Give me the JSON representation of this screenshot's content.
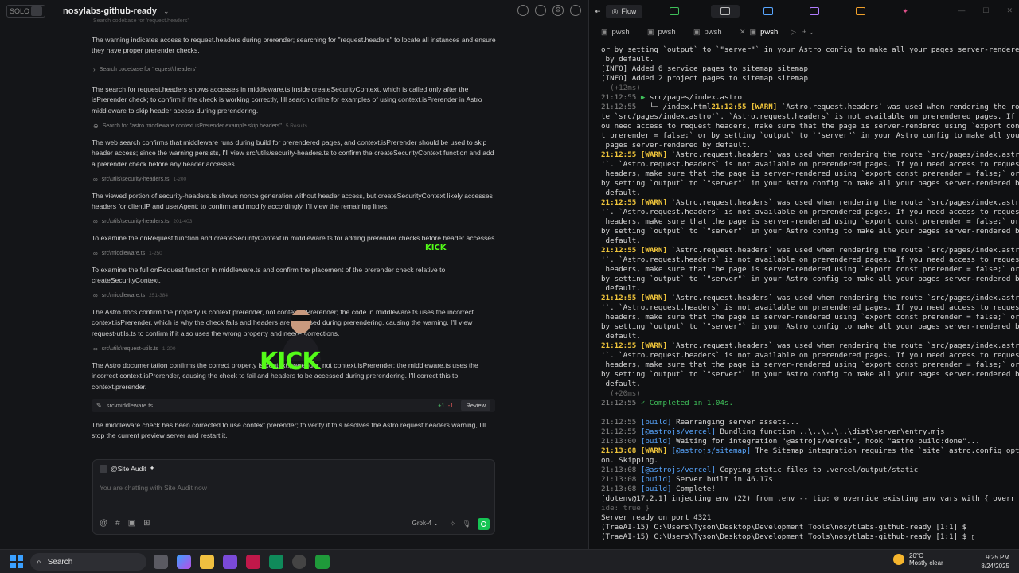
{
  "header": {
    "solo_label": "SOLO",
    "project_name": "nosylabs-github-ready"
  },
  "chat": {
    "fragment_top": "Search codebase for 'request.headers'",
    "para1": "The warning indicates access to request.headers during prerender; searching for \"request.headers\" to locate all instances and ensure they have proper prerender checks.",
    "tool1": "Search codebase for 'request\\.headers'",
    "para2": "The search for request.headers shows accesses in middleware.ts inside createSecurityContext, which is called only after the isPrerender check; to confirm if the check is working correctly, I'll search online for examples of using context.isPrerender in Astro middleware to skip header access during prerendering.",
    "tool2": "Search for \"astro middleware context.isPrerender example skip headers\"",
    "tool2_sub": "5 Results",
    "para3": "The web search confirms that middleware runs during build for prerendered pages, and context.isPrerender should be used to skip header access; since the warning persists, I'll view src/utils/security-headers.ts to confirm the createSecurityContext function and add a prerender check before any header accesses.",
    "tool3": "src\\utils\\security-headers.ts",
    "tool3_sub": "1-200",
    "para4": "The viewed portion of security-headers.ts shows nonce generation without header access, but createSecurityContext likely accesses headers for clientIP and userAgent; to confirm and modify accordingly, I'll view the remaining lines.",
    "tool4": "src\\utils\\security-headers.ts",
    "tool4_sub": "201-403",
    "para5": "To examine the onRequest function and createSecurityContext in middleware.ts for adding prerender checks before header accesses.",
    "tool5": "src\\middleware.ts",
    "tool5_sub": "1-250",
    "para6": "To examine the full onRequest function in middleware.ts and confirm the placement of the prerender check relative to createSecurityContext.",
    "tool6": "src\\middleware.ts",
    "tool6_sub": "251-384",
    "para7": "The Astro docs confirm the property is context.prerender, not context.isPrerender; the code in middleware.ts uses the incorrect context.isPrerender, which is why the check fails and headers are accessed during prerendering, causing the warning. I'll view request-utils.ts to confirm if it also uses the wrong property and needs corrections.",
    "tool7": "src\\utils\\request-utils.ts",
    "tool7_sub": "1-200",
    "para8": "The Astro documentation confirms the correct property is context.prerender, not context.isPrerender; the middleware.ts uses the incorrect context.isPrerender, causing the check to fail and headers to be accessed during prerendering. I'll correct this to context.prerender.",
    "diff_file": "src\\middleware.ts",
    "diff_plus": "+1",
    "diff_minus": "-1",
    "diff_review": "Review",
    "para9": "The middleware check has been corrected to use context.prerender; to verify if this resolves the Astro.request.headers warning, I'll stop the current preview server and restart it."
  },
  "composer": {
    "agent": "@Site Audit",
    "placeholder": "You are chatting with Site Audit now",
    "model": "Grok-4"
  },
  "overlay": {
    "kick_big": "KICK",
    "kick_small": "KICK"
  },
  "right_header": {
    "flow_label": "Flow"
  },
  "terminal_tabs": [
    "pwsh",
    "pwsh",
    "pwsh",
    "pwsh"
  ],
  "terminal_lines": [
    {
      "t": "or by setting `output` to `\"server\"` in your Astro config to make all your pages server-rendered",
      "c": ""
    },
    {
      "t": " by default.",
      "c": ""
    },
    {
      "t": "[INFO] Added 6 service pages to sitemap sitemap",
      "c": ""
    },
    {
      "t": "[INFO] Added 2 project pages to sitemap sitemap",
      "c": ""
    },
    {
      "t": "  (+12ms)",
      "c": "dim"
    },
    {
      "t": "21:12:55 ▶ src/pages/index.astro",
      "c": "mixed1"
    },
    {
      "t": "21:12:55   └─ /index.html21:12:55 [WARN] `Astro.request.headers` was used when rendering the rou",
      "c": "mixed2"
    },
    {
      "t": "te `src/pages/index.astro'`. `Astro.request.headers` is not available on prerendered pages. If y",
      "c": ""
    },
    {
      "t": "ou need access to request headers, make sure that the page is server-rendered using `export cons",
      "c": ""
    },
    {
      "t": "t prerender = false;` or by setting `output` to `\"server\"` in your Astro config to make all your",
      "c": ""
    },
    {
      "t": " pages server-rendered by default.",
      "c": ""
    },
    {
      "t": "21:12:55 [WARN] `Astro.request.headers` was used when rendering the route `src/pages/index.astro",
      "c": "warnline"
    },
    {
      "t": "'`. `Astro.request.headers` is not available on prerendered pages. If you need access to request",
      "c": ""
    },
    {
      "t": " headers, make sure that the page is server-rendered using `export const prerender = false;` or",
      "c": ""
    },
    {
      "t": "by setting `output` to `\"server\"` in your Astro config to make all your pages server-rendered by",
      "c": ""
    },
    {
      "t": " default.",
      "c": ""
    },
    {
      "t": "21:12:55 [WARN] `Astro.request.headers` was used when rendering the route `src/pages/index.astro",
      "c": "warnline"
    },
    {
      "t": "'`. `Astro.request.headers` is not available on prerendered pages. If you need access to request",
      "c": ""
    },
    {
      "t": " headers, make sure that the page is server-rendered using `export const prerender = false;` or",
      "c": ""
    },
    {
      "t": "by setting `output` to `\"server\"` in your Astro config to make all your pages server-rendered by",
      "c": ""
    },
    {
      "t": " default.",
      "c": ""
    },
    {
      "t": "21:12:55 [WARN] `Astro.request.headers` was used when rendering the route `src/pages/index.astro",
      "c": "warnline"
    },
    {
      "t": "'`. `Astro.request.headers` is not available on prerendered pages. If you need access to request",
      "c": ""
    },
    {
      "t": " headers, make sure that the page is server-rendered using `export const prerender = false;` or",
      "c": ""
    },
    {
      "t": "by setting `output` to `\"server\"` in your Astro config to make all your pages server-rendered by",
      "c": ""
    },
    {
      "t": " default.",
      "c": ""
    },
    {
      "t": "21:12:55 [WARN] `Astro.request.headers` was used when rendering the route `src/pages/index.astro",
      "c": "warnline"
    },
    {
      "t": "'`. `Astro.request.headers` is not available on prerendered pages. If you need access to request",
      "c": ""
    },
    {
      "t": " headers, make sure that the page is server-rendered using `export const prerender = false;` or",
      "c": ""
    },
    {
      "t": "by setting `output` to `\"server\"` in your Astro config to make all your pages server-rendered by",
      "c": ""
    },
    {
      "t": " default.",
      "c": ""
    },
    {
      "t": "21:12:55 [WARN] `Astro.request.headers` was used when rendering the route `src/pages/index.astro",
      "c": "warnline"
    },
    {
      "t": "'`. `Astro.request.headers` is not available on prerendered pages. If you need access to request",
      "c": ""
    },
    {
      "t": " headers, make sure that the page is server-rendered using `export const prerender = false;` or",
      "c": ""
    },
    {
      "t": "by setting `output` to `\"server\"` in your Astro config to make all your pages server-rendered by",
      "c": ""
    },
    {
      "t": " default.",
      "c": ""
    },
    {
      "t": "  (+20ms)",
      "c": "dim"
    },
    {
      "t": "21:12:55 ✓ Completed in 1.04s.",
      "c": "completed"
    },
    {
      "t": "",
      "c": ""
    },
    {
      "t": "21:12:55 [build] Rearranging server assets...",
      "c": "build"
    },
    {
      "t": "21:12:55 [@astrojs/vercel] Bundling function ..\\..\\..\\..\\dist\\server\\entry.mjs",
      "c": "build"
    },
    {
      "t": "21:13:00 [build] Waiting for integration \"@astrojs/vercel\", hook \"astro:build:done\"...",
      "c": "build"
    },
    {
      "t": "21:13:08 [WARN] [@astrojs/sitemap] The Sitemap integration requires the `site` astro.config opti",
      "c": "warnline"
    },
    {
      "t": "on. Skipping.",
      "c": ""
    },
    {
      "t": "21:13:08 [@astrojs/vercel] Copying static files to .vercel/output/static",
      "c": "build"
    },
    {
      "t": "21:13:08 [build] Server built in 46.17s",
      "c": "build"
    },
    {
      "t": "21:13:08 [build] Complete!",
      "c": "build"
    },
    {
      "t": "[dotenv@17.2.1] injecting env (22) from .env -- tip: ⚙ override existing env vars with { overr",
      "c": ""
    },
    {
      "t": "ide: true }",
      "c": "dim"
    },
    {
      "t": "Server ready on port 4321",
      "c": ""
    },
    {
      "t": "(TraeAI-15) C:\\Users\\Tyson\\Desktop\\Development Tools\\nosytlabs-github-ready [1:1] $",
      "c": ""
    },
    {
      "t": "(TraeAI-15) C:\\Users\\Tyson\\Desktop\\Development Tools\\nosytlabs-github-ready [1:1] $ ▯",
      "c": ""
    }
  ],
  "taskbar": {
    "search_label": "Search",
    "weather_temp": "20°C",
    "weather_desc": "Mostly clear",
    "time": "9:25 PM",
    "date": "8/24/2025"
  }
}
